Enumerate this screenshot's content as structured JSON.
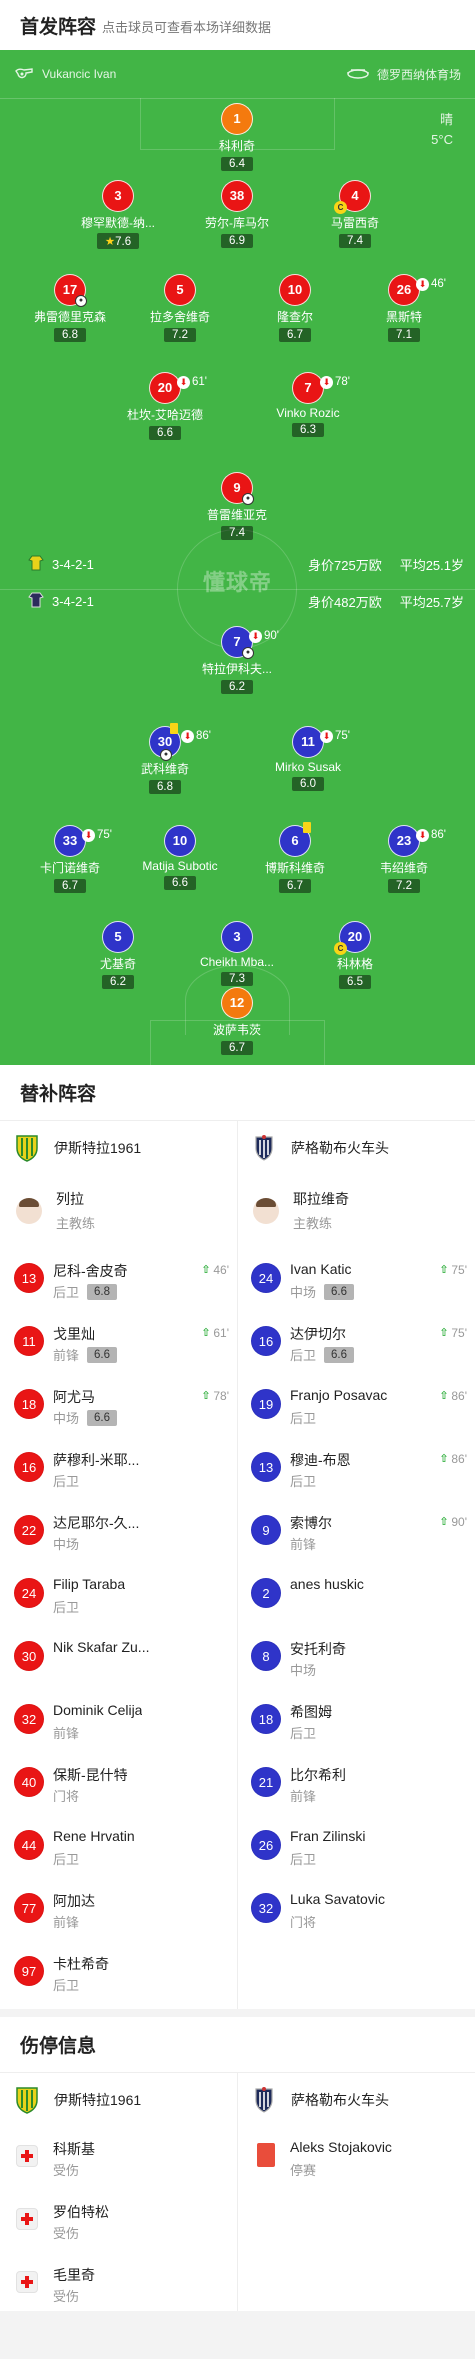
{
  "header": {
    "title": "首发阵容",
    "subtitle": "点击球员可查看本场详细数据"
  },
  "venue": {
    "referee": "Vukancic Ivan",
    "stadium": "德罗西纳体育场",
    "weather": "晴",
    "temperature": "5°C"
  },
  "home_team": {
    "formation": "3-4-2-1",
    "value": "身价725万欧",
    "avg_age": "平均25.1岁",
    "lineup": [
      {
        "number": "1",
        "name": "科利奇",
        "rating": "6.4"
      },
      {
        "number": "3",
        "name": "穆罕默德-纳...",
        "rating": "7.6",
        "best": true
      },
      {
        "number": "38",
        "name": "劳尔-库马尔",
        "rating": "6.9"
      },
      {
        "number": "4",
        "name": "马雷西奇",
        "rating": "7.4",
        "captain": true
      },
      {
        "number": "17",
        "name": "弗雷德里克森",
        "rating": "6.8"
      },
      {
        "number": "5",
        "name": "拉多舍维奇",
        "rating": "7.2"
      },
      {
        "number": "10",
        "name": "隆查尔",
        "rating": "6.7"
      },
      {
        "number": "26",
        "name": "黑斯特",
        "rating": "7.1",
        "sub_out": "46'"
      },
      {
        "number": "20",
        "name": "杜坎-艾哈迈德",
        "rating": "6.6",
        "sub_out": "61'"
      },
      {
        "number": "7",
        "name": "Vinko Rozic",
        "rating": "6.3",
        "sub_out": "78'"
      },
      {
        "number": "9",
        "name": "普雷维亚克",
        "rating": "7.4"
      }
    ]
  },
  "away_team": {
    "formation": "3-4-2-1",
    "value": "身价482万欧",
    "avg_age": "平均25.7岁",
    "lineup": [
      {
        "number": "7",
        "name": "特拉伊科夫...",
        "rating": "6.2",
        "sub_out": "90'"
      },
      {
        "number": "30",
        "name": "武科维奇",
        "rating": "6.8",
        "sub_out": "86'"
      },
      {
        "number": "11",
        "name": "Mirko Susak",
        "rating": "6.0",
        "sub_out": "75'"
      },
      {
        "number": "33",
        "name": "卡门诺维奇",
        "rating": "6.7",
        "sub_out": "75'"
      },
      {
        "number": "10",
        "name": "Matija Subotic",
        "rating": "6.6"
      },
      {
        "number": "6",
        "name": "博斯科维奇",
        "rating": "6.7"
      },
      {
        "number": "23",
        "name": "韦绍维奇",
        "rating": "7.2",
        "sub_out": "86'"
      },
      {
        "number": "5",
        "name": "尤基奇",
        "rating": "6.2"
      },
      {
        "number": "3",
        "name": "Cheikh Mba...",
        "rating": "7.3"
      },
      {
        "number": "20",
        "name": "科林格",
        "rating": "6.5",
        "captain": true
      },
      {
        "number": "12",
        "name": "波萨韦茨",
        "rating": "6.7"
      }
    ]
  },
  "subs_section": {
    "title": "替补阵容",
    "home_team_name": "伊斯特拉1961",
    "away_team_name": "萨格勒布火车头",
    "home_coach": {
      "name": "列拉",
      "role": "主教练"
    },
    "away_coach": {
      "name": "耶拉维奇",
      "role": "主教练"
    },
    "home": [
      {
        "number": "13",
        "name": "尼科-舍皮奇",
        "pos": "后卫",
        "rating": "6.8",
        "time": "46'"
      },
      {
        "number": "11",
        "name": "戈里灿",
        "pos": "前锋",
        "rating": "6.6",
        "time": "61'"
      },
      {
        "number": "18",
        "name": "阿尤马",
        "pos": "中场",
        "rating": "6.6",
        "time": "78'"
      },
      {
        "number": "16",
        "name": "萨穆利-米耶...",
        "pos": "后卫"
      },
      {
        "number": "22",
        "name": "达尼耶尔-久...",
        "pos": "中场"
      },
      {
        "number": "24",
        "name": "Filip Taraba",
        "pos": "后卫"
      },
      {
        "number": "30",
        "name": "Nik Skafar Zu...",
        "pos": ""
      },
      {
        "number": "32",
        "name": "Dominik Celija",
        "pos": "前锋"
      },
      {
        "number": "40",
        "name": "保斯-昆什特",
        "pos": "门将"
      },
      {
        "number": "44",
        "name": "Rene Hrvatin",
        "pos": "后卫"
      },
      {
        "number": "77",
        "name": "阿加达",
        "pos": "前锋"
      },
      {
        "number": "97",
        "name": "卡杜希奇",
        "pos": "后卫"
      }
    ],
    "away": [
      {
        "number": "24",
        "name": "Ivan Katic",
        "pos": "中场",
        "rating": "6.6",
        "time": "75'"
      },
      {
        "number": "16",
        "name": "达伊切尔",
        "pos": "后卫",
        "rating": "6.6",
        "time": "75'"
      },
      {
        "number": "19",
        "name": "Franjo Posavac",
        "pos": "后卫",
        "time": "86'"
      },
      {
        "number": "13",
        "name": "穆迪-布恩",
        "pos": "后卫",
        "time": "86'"
      },
      {
        "number": "9",
        "name": "索博尔",
        "pos": "前锋",
        "time": "90'"
      },
      {
        "number": "2",
        "name": "anes huskic",
        "pos": ""
      },
      {
        "number": "8",
        "name": "安托利奇",
        "pos": "中场"
      },
      {
        "number": "18",
        "name": "希图姆",
        "pos": "后卫"
      },
      {
        "number": "21",
        "name": "比尔希利",
        "pos": "前锋"
      },
      {
        "number": "26",
        "name": "Fran Zilinski",
        "pos": "后卫"
      },
      {
        "number": "32",
        "name": "Luka Savatovic",
        "pos": "门将"
      }
    ]
  },
  "injury_section": {
    "title": "伤停信息",
    "home_team_name": "伊斯特拉1961",
    "away_team_name": "萨格勒布火车头",
    "home": [
      {
        "name": "科斯基",
        "status": "受伤"
      },
      {
        "name": "罗伯特松",
        "status": "受伤"
      },
      {
        "name": "毛里奇",
        "status": "受伤"
      }
    ],
    "away": [
      {
        "name": "Aleks Stojakovic",
        "status": "停赛"
      }
    ]
  },
  "watermark": "懂球帝",
  "colors": {
    "pitch": "#42b546",
    "home_player": "#e91515",
    "away_player": "#2f34c9",
    "goalkeeper": "#f47a0e"
  }
}
